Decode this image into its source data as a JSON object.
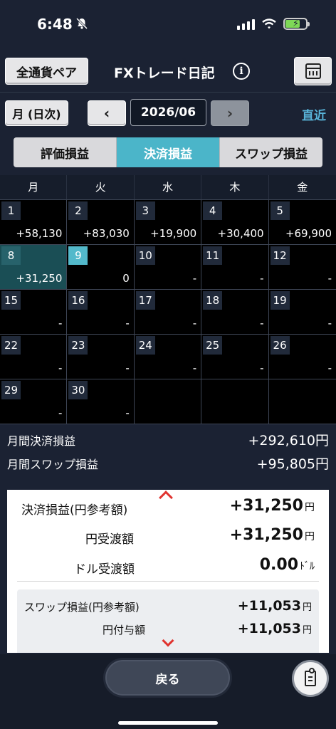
{
  "status": {
    "time": "6:48",
    "battery_color": "#7ed957"
  },
  "header": {
    "pair_button": "全通貨ペア",
    "title": "FXトレード日記",
    "info_icon": "info-icon",
    "calendar_icon": "calendar-icon"
  },
  "nav": {
    "mode_button": "月 (日次)",
    "prev_label": "‹",
    "month_value": "2026/06",
    "next_label": "›",
    "recent_link": "直近"
  },
  "tabs": [
    {
      "label": "評価損益",
      "active": false
    },
    {
      "label": "決済損益",
      "active": true
    },
    {
      "label": "スワップ損益",
      "active": false
    }
  ],
  "calendar": {
    "weekdays": [
      "月",
      "火",
      "水",
      "木",
      "金"
    ],
    "weeks": [
      [
        {
          "day": "1",
          "amount": "+58,130"
        },
        {
          "day": "2",
          "amount": "+83,030"
        },
        {
          "day": "3",
          "amount": "+19,900"
        },
        {
          "day": "4",
          "amount": "+30,400"
        },
        {
          "day": "5",
          "amount": "+69,900"
        }
      ],
      [
        {
          "day": "8",
          "amount": "+31,250",
          "state": "selected"
        },
        {
          "day": "9",
          "amount": "0",
          "state": "today"
        },
        {
          "day": "10",
          "amount": "-"
        },
        {
          "day": "11",
          "amount": "-"
        },
        {
          "day": "12",
          "amount": "-"
        }
      ],
      [
        {
          "day": "15",
          "amount": "-"
        },
        {
          "day": "16",
          "amount": "-"
        },
        {
          "day": "17",
          "amount": "-"
        },
        {
          "day": "18",
          "amount": "-"
        },
        {
          "day": "19",
          "amount": "-"
        }
      ],
      [
        {
          "day": "22",
          "amount": "-"
        },
        {
          "day": "23",
          "amount": "-"
        },
        {
          "day": "24",
          "amount": "-"
        },
        {
          "day": "25",
          "amount": "-"
        },
        {
          "day": "26",
          "amount": "-"
        }
      ],
      [
        {
          "day": "29",
          "amount": "-"
        },
        {
          "day": "30",
          "amount": "-"
        },
        {
          "day": "",
          "amount": ""
        },
        {
          "day": "",
          "amount": ""
        },
        {
          "day": "",
          "amount": ""
        }
      ]
    ]
  },
  "summary": {
    "settlement_label": "月間決済損益",
    "settlement_value": "+292,610円",
    "swap_label": "月間スワップ損益",
    "swap_value": "+95,805円"
  },
  "detail": {
    "settlement_label": "決済損益(円参考額)",
    "settlement_value": "+31,250",
    "settlement_unit": "円",
    "yen_delivery_label": "円受渡額",
    "yen_delivery_value": "+31,250",
    "yen_delivery_unit": "円",
    "usd_delivery_label": "ドル受渡額",
    "usd_delivery_value": "0.00",
    "usd_delivery_unit": "ﾄﾞﾙ",
    "swap_label": "スワップ損益(円参考額)",
    "swap_value": "+11,053",
    "swap_unit": "円",
    "yen_grant_label": "円付与額",
    "yen_grant_value": "+11,053",
    "yen_grant_unit": "円"
  },
  "bottom": {
    "back_label": "戻る"
  }
}
